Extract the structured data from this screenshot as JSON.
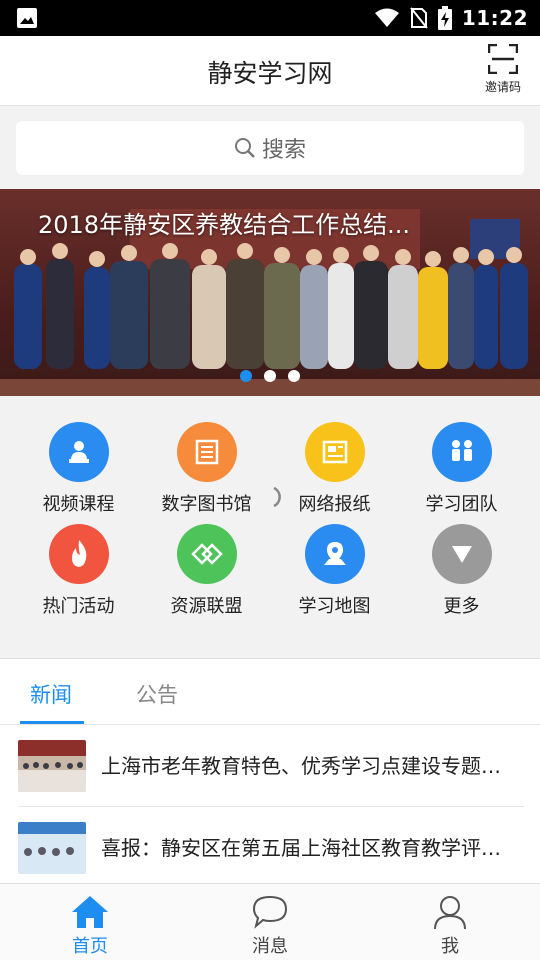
{
  "status": {
    "time": "11:22"
  },
  "header": {
    "title": "静安学习网",
    "invite_label": "邀请码"
  },
  "search": {
    "placeholder": "搜索"
  },
  "banner": {
    "caption": "2018年静安区养教结合工作总结...",
    "slides": 3,
    "active_slide": 1
  },
  "menu": [
    {
      "label": "视频课程",
      "icon": "video-course-icon",
      "color": "#2a8cf0"
    },
    {
      "label": "数字图书馆",
      "icon": "digital-library-icon",
      "color": "#f68b3c"
    },
    {
      "label": "网络报纸",
      "icon": "newspaper-icon",
      "color": "#f8c21a"
    },
    {
      "label": "学习团队",
      "icon": "team-icon",
      "color": "#2a8cf0"
    },
    {
      "label": "热门活动",
      "icon": "flame-icon",
      "color": "#f1543f"
    },
    {
      "label": "资源联盟",
      "icon": "alliance-icon",
      "color": "#4dc35a"
    },
    {
      "label": "学习地图",
      "icon": "map-pin-icon",
      "color": "#2a8cf0"
    },
    {
      "label": "更多",
      "icon": "more-down-icon",
      "color": "#9a9a9a"
    }
  ],
  "news": {
    "tabs": [
      "新闻",
      "公告"
    ],
    "active_tab": 0,
    "items": [
      {
        "title": "上海市老年教育特色、优秀学习点建设专题…"
      },
      {
        "title": "喜报：静安区在第五届上海社区教育教学评…"
      }
    ]
  },
  "bottom_nav": [
    {
      "label": "首页",
      "icon": "home-icon",
      "active": true
    },
    {
      "label": "消息",
      "icon": "message-icon",
      "active": false
    },
    {
      "label": "我",
      "icon": "user-icon",
      "active": false
    }
  ],
  "colors": {
    "accent": "#1d8ef0",
    "inactive": "#555555"
  }
}
